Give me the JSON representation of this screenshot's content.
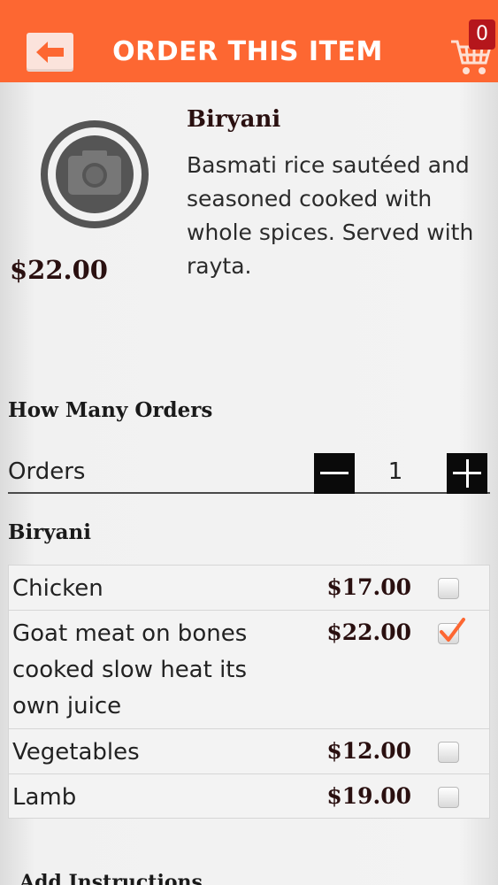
{
  "header": {
    "title": "ORDER THIS ITEM",
    "back_icon": "back-arrow-icon",
    "cart_icon": "shopping-cart-icon",
    "cart_count": "0",
    "accent_color": "#fd6732",
    "badge_color": "#b5161c"
  },
  "item": {
    "photo_icon": "camera-icon",
    "name": "Biryani",
    "description": "Basmati rice sautéed and seasoned cooked with whole spices. Served with rayta.",
    "price": "$22.00"
  },
  "quantity": {
    "heading": "How Many Orders",
    "label": "Orders",
    "value": "1",
    "minus_icon": "minus-icon",
    "plus_icon": "plus-icon"
  },
  "options": {
    "heading": "Biryani",
    "items": [
      {
        "name": "Chicken",
        "price": "$17.00",
        "checked": false
      },
      {
        "name": "Goat meat on bones cooked slow heat its own juice",
        "price": "$22.00",
        "checked": true
      },
      {
        "name": "Vegetables",
        "price": "$12.00",
        "checked": false
      },
      {
        "name": "Lamb",
        "price": "$19.00",
        "checked": false
      }
    ]
  },
  "instructions": {
    "heading": "Add Instructions"
  }
}
